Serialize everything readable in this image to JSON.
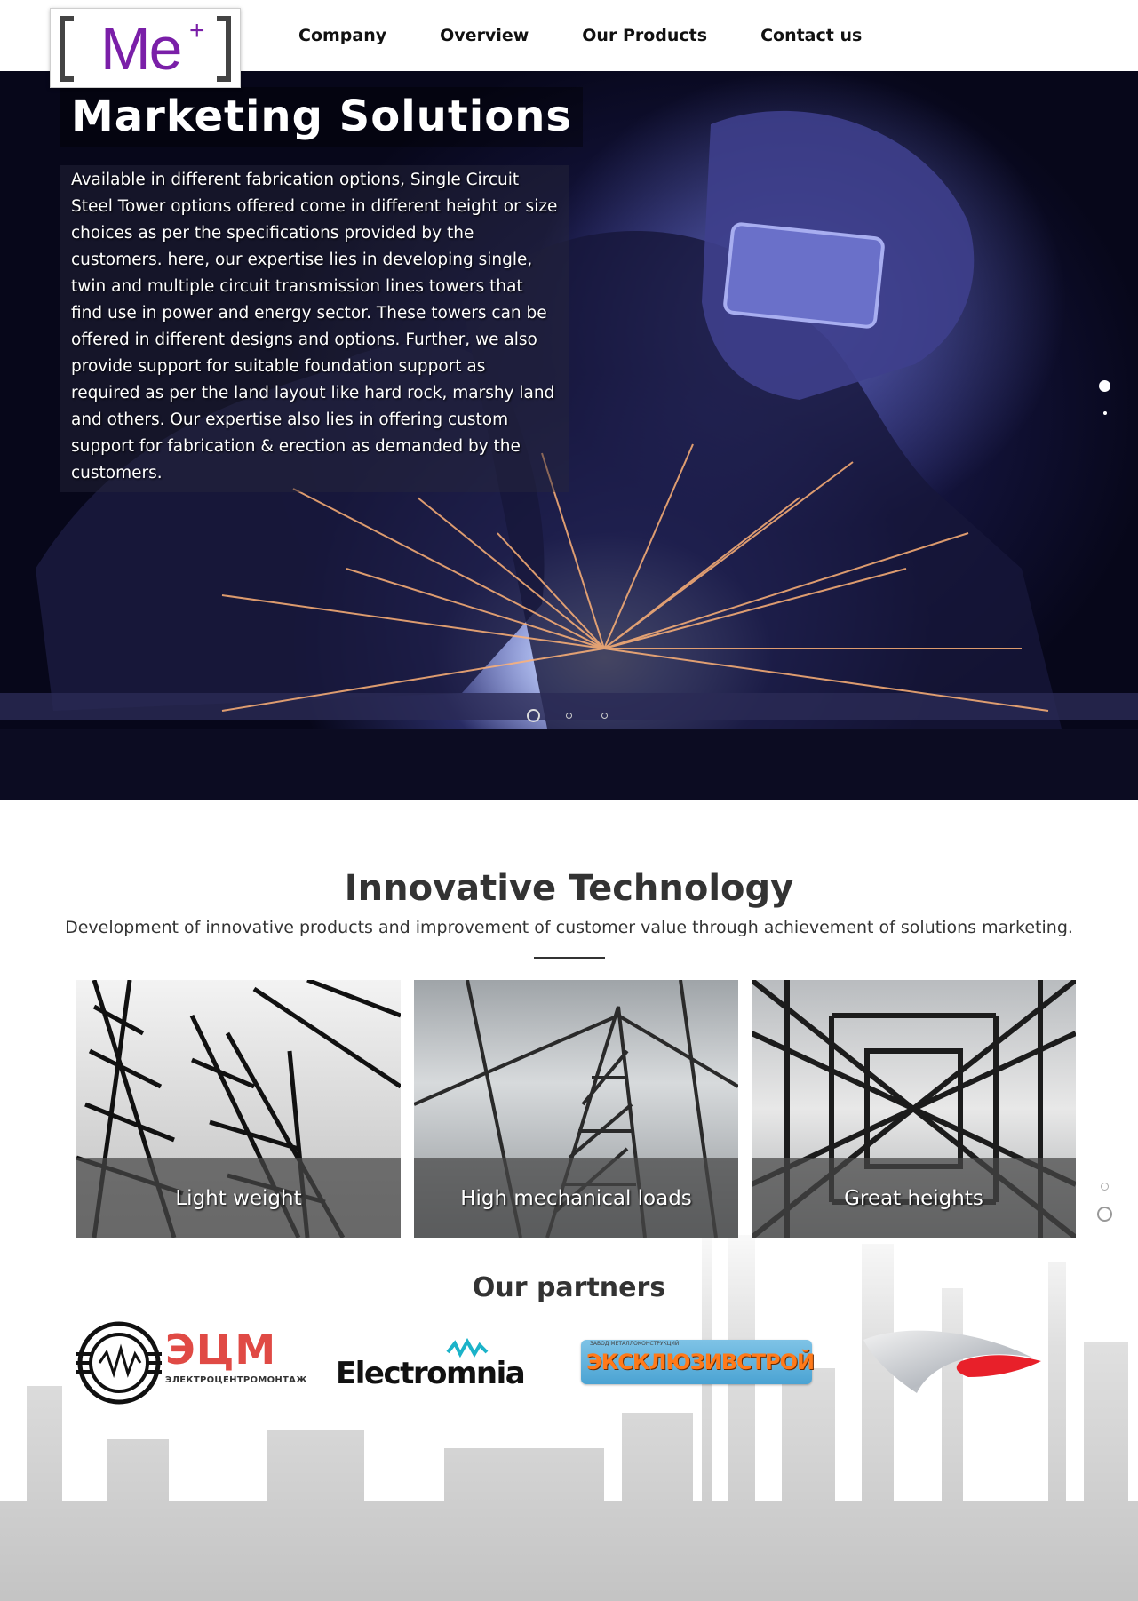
{
  "header": {
    "logo": {
      "text": "Me",
      "superscript": "+",
      "brand_color": "#7a1fa8",
      "bracket_color": "#444444"
    },
    "nav": [
      {
        "label": "Company"
      },
      {
        "label": "Overview"
      },
      {
        "label": "Our Products"
      },
      {
        "label": "Contact us"
      }
    ]
  },
  "hero": {
    "title": "Marketing Solutions",
    "text": "Available in different fabrication options, Single Circuit Steel Tower options offered come in different height or size choices as per the specifications provided by the customers. here, our expertise lies in developing single, twin and multiple circuit transmission lines towers that find use in power and energy sector. These towers can be offered in different designs and options. Further, we also provide support for suitable foundation support as required as per the land layout like hard rock, marshy land and others. Our expertise also lies in offering custom support for fabrication & erection as demanded by the customers.",
    "slider_dots": 3,
    "active_slide": 1,
    "vertical_dots": 2
  },
  "innovative": {
    "title": "Innovative Technology",
    "subtitle": "Development of innovative products and improvement of customer value through achievement of solutions marketing.",
    "cards": [
      {
        "caption": "Light weight"
      },
      {
        "caption": "High mechanical loads"
      },
      {
        "caption": "Great heights"
      }
    ]
  },
  "partners": {
    "title": "Our partners",
    "logos": [
      {
        "name": "ЭЦМ",
        "subtitle": "ЭЛЕКТРОЦЕНТРОМОНТАЖ",
        "color": "#e04a45"
      },
      {
        "name": "Electromnia",
        "accent": "#1bb3c9"
      },
      {
        "name": "ЭКСКЛЮЗИВСТРОЙ",
        "tagline": "ЗАВОД МЕТАЛЛОКОНСТРУКЦИЙ",
        "color": "#ff7a1a"
      },
      {
        "name": "",
        "accent": "#e8202a"
      }
    ]
  }
}
